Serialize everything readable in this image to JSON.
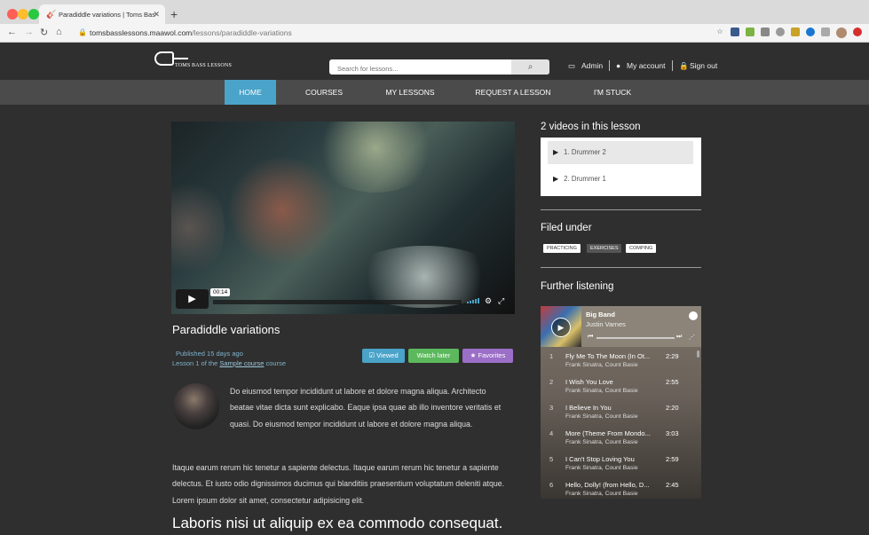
{
  "browser": {
    "tab_title": "Paradiddle variations | Toms Bas",
    "url_host": "tomsbasslessons.maawol.com",
    "url_path": "/lessons/paradiddle-variations"
  },
  "header": {
    "logo_text": "TOMS BASS LESSONS",
    "search_placeholder": "Search for lessons...",
    "admin": "Admin",
    "account": "My account",
    "signout": "Sign out"
  },
  "nav": {
    "items": [
      "HOME",
      "COURSES",
      "MY LESSONS",
      "REQUEST A LESSON",
      "I'M STUCK"
    ]
  },
  "video": {
    "time": "00:14"
  },
  "lesson": {
    "title": "Paradiddle variations",
    "published": "Published 15 days ago",
    "lesson_of_prefix": "Lesson 1 of the ",
    "course_link": "Sample course",
    "course_suffix": " course",
    "viewed": "Viewed",
    "watch_later": "Watch later",
    "favorites": "Favorites",
    "para1": "Do eiusmod tempor incididunt ut labore et dolore magna aliqua. Architecto beatae vitae dicta sunt explicabo. Eaque ipsa quae ab illo inventore veritatis et quasi. Do eiusmod tempor incididunt ut labore et dolore magna aliqua.",
    "para2": "Itaque earum rerum hic tenetur a sapiente delectus. Itaque earum rerum hic tenetur a sapiente delectus. Et iusto odio dignissimos ducimus qui blanditiis praesentium voluptatum deleniti atque. Lorem ipsum dolor sit amet, consectetur adipisicing elit.",
    "heading2": "Laboris nisi ut aliquip ex ea commodo consequat."
  },
  "sidebar": {
    "videos_heading": "2 videos in this lesson",
    "videos": [
      "1. Drummer 2",
      "2. Drummer 1"
    ],
    "filed_heading": "Filed under",
    "tags": [
      "PRACTICING",
      "EXERCISES",
      "COMPING"
    ],
    "further_heading": "Further listening"
  },
  "player": {
    "title": "Big Band",
    "artist": "Justin Varnes",
    "tracks": [
      {
        "n": "1",
        "title": "Fly Me To The Moon (In Ot...",
        "artist": "Frank Sinatra, Count Basie",
        "dur": "2:29"
      },
      {
        "n": "2",
        "title": "I Wish You Love",
        "artist": "Frank Sinatra, Count Basie",
        "dur": "2:55"
      },
      {
        "n": "3",
        "title": "I Believe In You",
        "artist": "Frank Sinatra, Count Basie",
        "dur": "2:20"
      },
      {
        "n": "4",
        "title": "More (Theme From Mondo...",
        "artist": "Frank Sinatra, Count Basie",
        "dur": "3:03"
      },
      {
        "n": "5",
        "title": "I Can't Stop Loving You",
        "artist": "Frank Sinatra, Count Basie",
        "dur": "2:59"
      },
      {
        "n": "6",
        "title": "Hello, Dolly! (from Hello, D...",
        "artist": "Frank Sinatra, Count Basie",
        "dur": "2:45"
      }
    ]
  },
  "colors": {
    "accent": "#4aa3c8",
    "viewed_btn": "#4aa3c8",
    "watch_later_btn": "#5cb85c",
    "favorites_btn": "#9b6ec7"
  }
}
